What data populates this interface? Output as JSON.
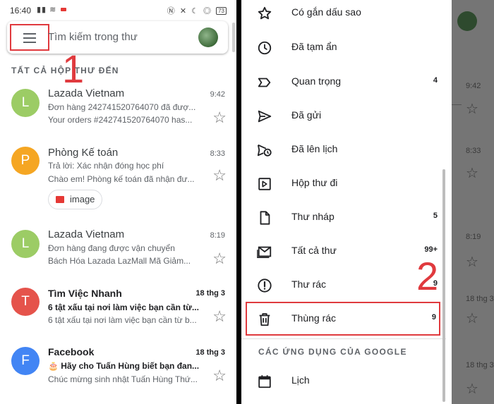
{
  "status_bar": {
    "time": "16:40",
    "left_icons": "▪▪ ≋",
    "right_icons": "Ⓝ ✕ ☾ ◎",
    "battery": "73"
  },
  "search": {
    "placeholder": "Tìm kiếm trong thư"
  },
  "annotations": {
    "step1": "1",
    "step2": "2",
    "highlight_color": "#e03a3e"
  },
  "inbox": {
    "section_title": "TẤT CẢ HỘP THƯ ĐẾN",
    "mails": [
      {
        "avatar_letter": "L",
        "avatar_color": "#9ccc65",
        "sender": "Lazada Vietnam",
        "time": "9:42",
        "subject": "Đơn hàng 242741520764070 đã đượ...",
        "snippet": "Your orders #242741520764070 has...",
        "unread": false
      },
      {
        "avatar_letter": "P",
        "avatar_color": "#f5a623",
        "sender": "Phòng Kế toán",
        "time": "8:33",
        "subject": "Trả lời: Xác nhận đóng học phí",
        "snippet": "Chào em! Phòng kế toán đã nhận đư...",
        "attachment": "image",
        "unread": false
      },
      {
        "avatar_letter": "L",
        "avatar_color": "#9ccc65",
        "sender": "Lazada Vietnam",
        "time": "8:19",
        "subject": "Đơn hàng đang được vận chuyển",
        "snippet": "Bách Hóa Lazada LazMall Mã Giảm...",
        "unread": false
      },
      {
        "avatar_letter": "T",
        "avatar_color": "#e5534b",
        "sender": "Tìm Việc Nhanh",
        "time": "18 thg 3",
        "subject": "6 tật xấu tại nơi làm việc bạn cần từ...",
        "snippet": "6 tật xấu tại nơi làm việc bạn cần từ b...",
        "unread": true
      },
      {
        "avatar_letter": "F",
        "avatar_color": "#4285f4",
        "sender": "Facebook",
        "time": "18 thg 3",
        "subject": "🎂 Hãy cho Tuấn Hùng biết bạn đan...",
        "snippet": "Chúc mừng sinh nhật Tuấn Hùng Thứ...",
        "unread": true
      }
    ]
  },
  "drawer": {
    "items": [
      {
        "icon": "star-icon",
        "label": "Có gắn dấu sao",
        "count": ""
      },
      {
        "icon": "clock-icon",
        "label": "Đã tạm ẩn",
        "count": ""
      },
      {
        "icon": "label-important-icon",
        "label": "Quan trọng",
        "count": "4"
      },
      {
        "icon": "send-icon",
        "label": "Đã gửi",
        "count": ""
      },
      {
        "icon": "scheduled-send-icon",
        "label": "Đã lên lịch",
        "count": ""
      },
      {
        "icon": "outbox-icon",
        "label": "Hộp thư đi",
        "count": ""
      },
      {
        "icon": "draft-icon",
        "label": "Thư nháp",
        "count": "5"
      },
      {
        "icon": "all-mail-icon",
        "label": "Tất cả thư",
        "count": "99+"
      },
      {
        "icon": "spam-icon",
        "label": "Thư rác",
        "count": "9"
      },
      {
        "icon": "trash-icon",
        "label": "Thùng rác",
        "count": "9"
      }
    ],
    "google_apps_section": "CÁC ỨNG DỤNG CỦA GOOGLE",
    "app_items": [
      {
        "icon": "calendar-icon",
        "label": "Lịch"
      }
    ]
  },
  "background_inbox": {
    "times": [
      "9:42",
      "8:33",
      "8:19",
      "18 thg 3",
      "18 thg 3"
    ]
  }
}
